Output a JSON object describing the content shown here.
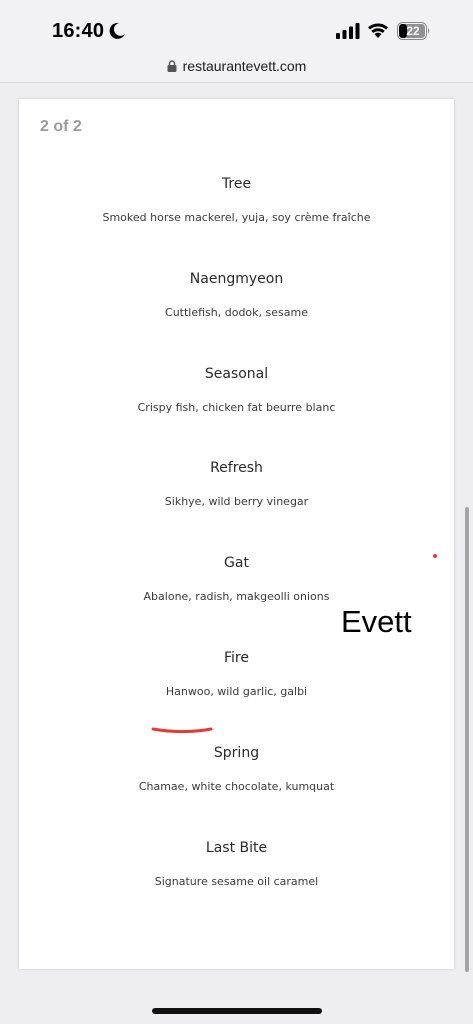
{
  "status_bar": {
    "time": "16:40",
    "battery_level": "22",
    "icons": [
      "moon-icon",
      "cellular-signal-icon",
      "wifi-icon",
      "battery-icon"
    ]
  },
  "browser": {
    "url": "restaurantevett.com",
    "lock_icon": "lock-icon"
  },
  "document": {
    "page_counter": "2 of 2",
    "courses": [
      {
        "name": "Tree",
        "description": "Smoked horse mackerel, yuja, soy crème fraîche"
      },
      {
        "name": "Naengmyeon",
        "description": "Cuttlefish, dodok, sesame"
      },
      {
        "name": "Seasonal",
        "description": "Crispy fish, chicken fat beurre blanc"
      },
      {
        "name": "Refresh",
        "description": "Sikhye, wild berry vinegar"
      },
      {
        "name": "Gat",
        "description": "Abalone, radish, makgeolli onions"
      },
      {
        "name": "Fire",
        "description": "Hanwoo, wild garlic, galbi"
      },
      {
        "name": "Spring",
        "description": "Chamae, white chocolate, kumquat"
      },
      {
        "name": "Last Bite",
        "description": "Signature sesame oil caramel"
      }
    ]
  },
  "annotation": {
    "text": "Evett",
    "color": "#e53935"
  }
}
